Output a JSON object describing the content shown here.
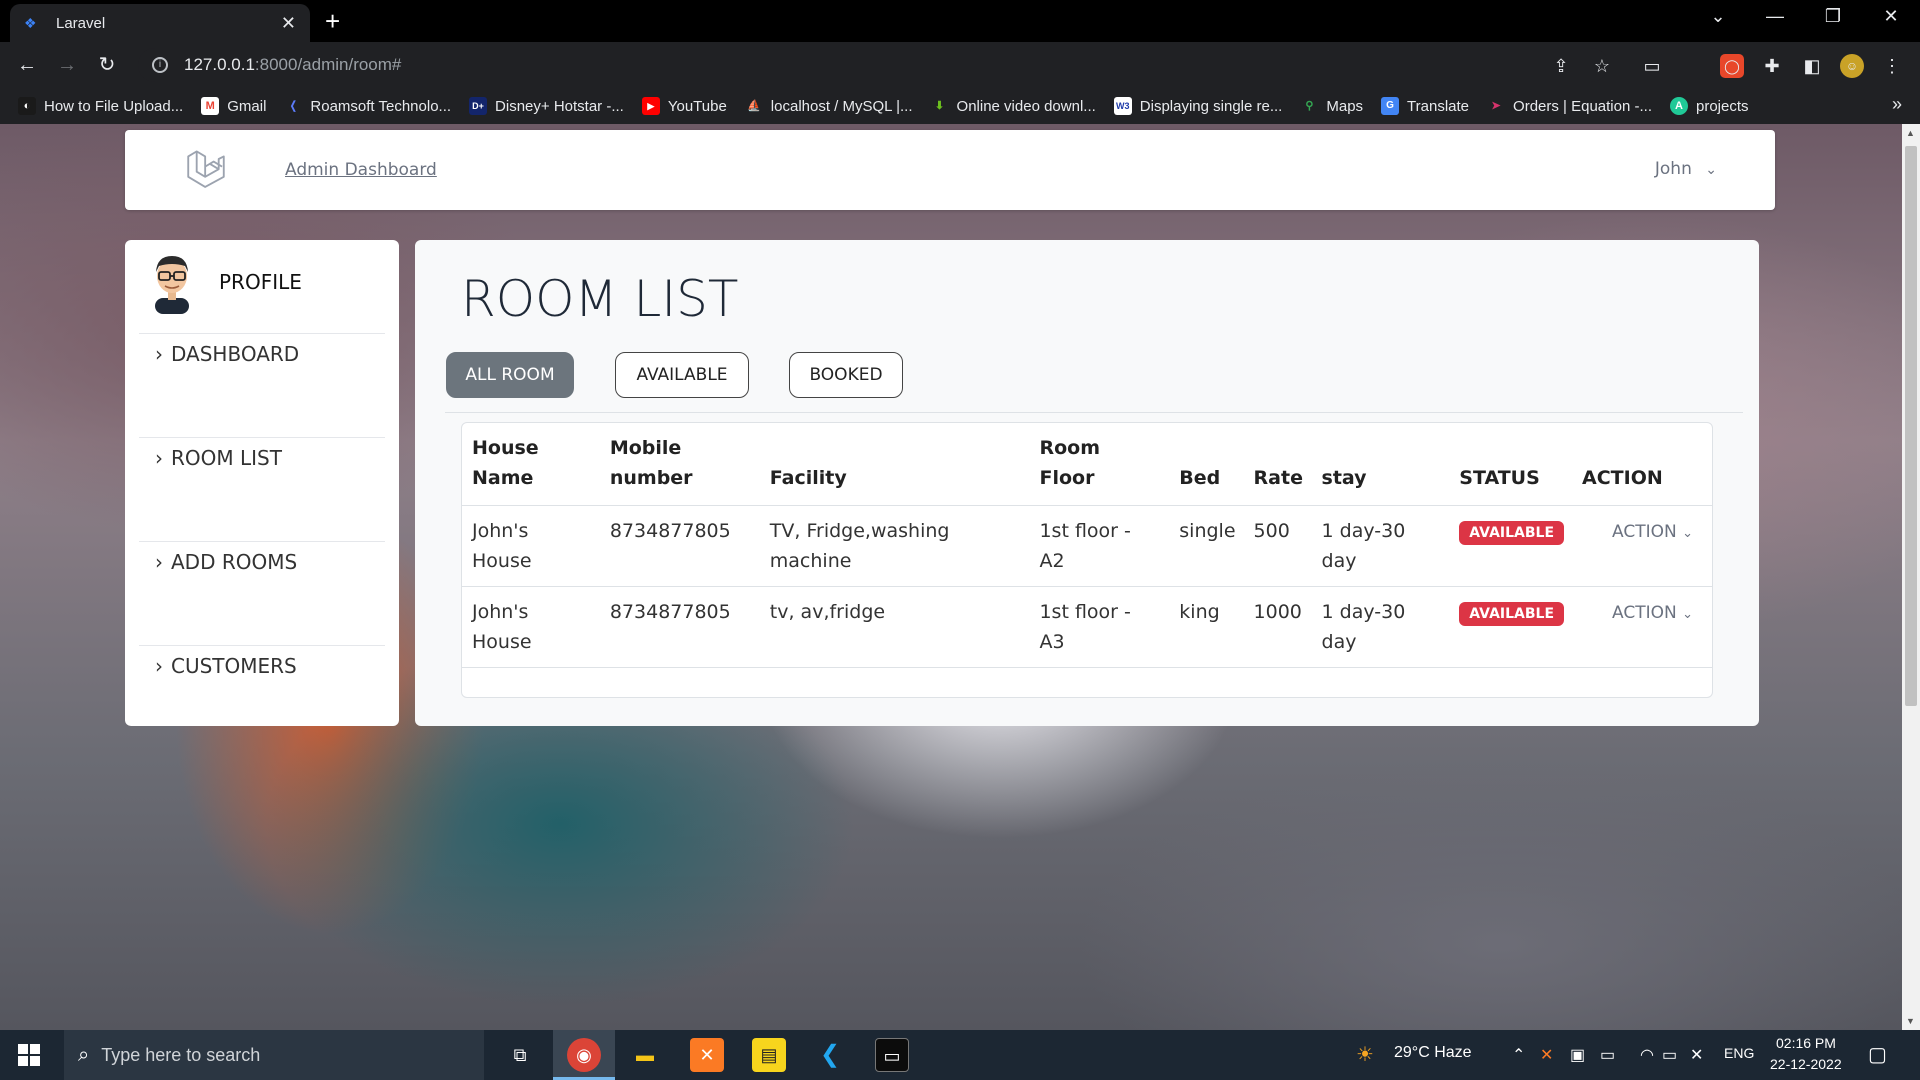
{
  "browser": {
    "tab_title": "Laravel",
    "tab_close": "✕",
    "new_tab": "+",
    "url_host": "127.0.0.1",
    "url_path": ":8000/admin/room#",
    "bookmarks": [
      {
        "label": "How to File Upload...",
        "icon": "upload-icon",
        "color": "#1a1a1a"
      },
      {
        "label": "Gmail",
        "icon": "gmail-icon",
        "color": "#ea4335"
      },
      {
        "label": "Roamsoft Technolo...",
        "icon": "roamsoft-icon",
        "color": "#3b5bdb"
      },
      {
        "label": "Disney+ Hotstar -...",
        "icon": "hotstar-icon",
        "color": "#13256b"
      },
      {
        "label": "YouTube",
        "icon": "youtube-icon",
        "color": "#ff0000"
      },
      {
        "label": "localhost / MySQL |...",
        "icon": "phpmyadmin-icon",
        "color": "#f29111"
      },
      {
        "label": "Online video downl...",
        "icon": "download-icon",
        "color": "#6cbf1f"
      },
      {
        "label": "Displaying single re...",
        "icon": "w3-icon",
        "color": "#1e3aa8"
      },
      {
        "label": "Maps",
        "icon": "maps-icon",
        "color": "#34a853"
      },
      {
        "label": "Translate",
        "icon": "translate-icon",
        "color": "#4285f4"
      },
      {
        "label": "Orders | Equation -...",
        "icon": "equation-icon",
        "color": "#d6336c"
      },
      {
        "label": "projects",
        "icon": "projects-icon",
        "color": "#20c997"
      }
    ],
    "bookmarks_more": "»"
  },
  "navbar": {
    "brand_link": "Admin Dashboard",
    "user_name": "John",
    "user_caret": "⌄"
  },
  "sidebar": {
    "profile_label": "PROFILE",
    "items": [
      {
        "label": "DASHBOARD"
      },
      {
        "label": "ROOM LIST"
      },
      {
        "label": "ADD ROOMS"
      },
      {
        "label": "CUSTOMERS"
      }
    ]
  },
  "main": {
    "title": "ROOM LIST",
    "filters": [
      {
        "label": "ALL ROOM",
        "active": true
      },
      {
        "label": "AVAILABLE",
        "active": false
      },
      {
        "label": "BOOKED",
        "active": false
      }
    ],
    "table": {
      "headers": {
        "house_line1": "House",
        "house_line2": "Name",
        "mobile_line1": "Mobile",
        "mobile_line2": "number",
        "facility": "Facility",
        "room_floor": "Room Floor",
        "bed": "Bed",
        "rate": "Rate",
        "stay": "stay",
        "status": "STATUS",
        "action": "ACTION"
      },
      "rows": [
        {
          "house": "John's House",
          "mobile": "8734877805",
          "facility": "TV, Fridge,washing machine",
          "floor": "1st floor - A2",
          "bed": "single",
          "rate": "500",
          "stay": "1 day-30 day",
          "status": "AVAILABLE",
          "action": "ACTION"
        },
        {
          "house": "John's House",
          "mobile": "8734877805",
          "facility": "tv, av,fridge",
          "floor": "1st floor - A3",
          "bed": "king",
          "rate": "1000",
          "stay": "1 day-30 day",
          "status": "AVAILABLE",
          "action": "ACTION"
        }
      ]
    }
  },
  "taskbar": {
    "search_placeholder": "Type here to search",
    "weather": "29°C  Haze",
    "language": "ENG",
    "time": "02:16 PM",
    "date": "22-12-2022"
  },
  "colors": {
    "accent_red": "#dc3545",
    "button_gray": "#6c757d"
  }
}
